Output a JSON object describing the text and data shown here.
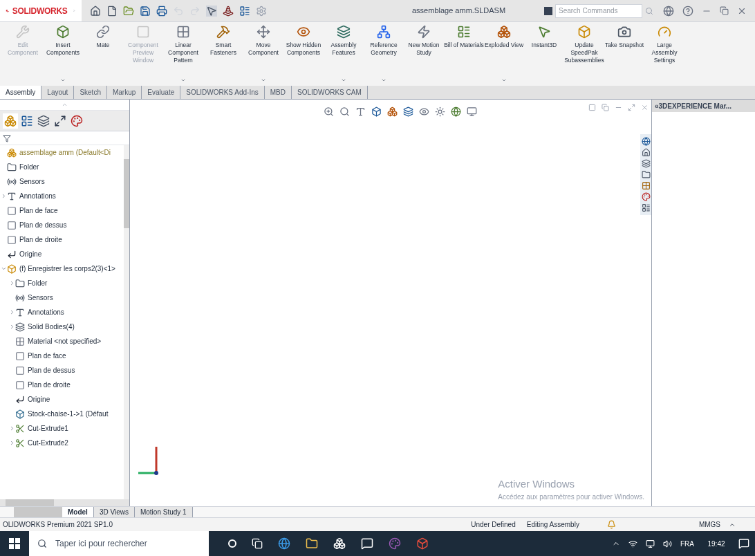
{
  "app": {
    "logo": "SOLIDWORKS",
    "document_title": "assemblage amm.SLDASM",
    "search": {
      "placeholder": "Search Commands"
    }
  },
  "ribbon": [
    {
      "label": "Edit Component",
      "disabled": true,
      "dropdown": false,
      "kind": "edit"
    },
    {
      "label": "Insert Components",
      "disabled": false,
      "dropdown": true,
      "kind": "insert"
    },
    {
      "label": "Mate",
      "disabled": false,
      "dropdown": false,
      "kind": "mate"
    },
    {
      "label": "Component Preview Window",
      "disabled": true,
      "dropdown": false,
      "kind": "preview"
    },
    {
      "label": "Linear Component Pattern",
      "disabled": false,
      "dropdown": true,
      "kind": "pattern"
    },
    {
      "label": "Smart Fasteners",
      "disabled": false,
      "dropdown": false,
      "kind": "fastener"
    },
    {
      "label": "Move Component",
      "disabled": false,
      "dropdown": true,
      "kind": "move"
    },
    {
      "label": "Show Hidden Components",
      "disabled": false,
      "dropdown": false,
      "kind": "show"
    },
    {
      "label": "Assembly Features",
      "disabled": false,
      "dropdown": true,
      "kind": "features"
    },
    {
      "label": "Reference Geometry",
      "disabled": false,
      "dropdown": true,
      "kind": "geometry"
    },
    {
      "label": "New Motion Study",
      "disabled": false,
      "dropdown": false,
      "kind": "motion"
    },
    {
      "label": "Bill of Materials",
      "disabled": false,
      "dropdown": false,
      "kind": "bom"
    },
    {
      "label": "Exploded View",
      "disabled": false,
      "dropdown": true,
      "kind": "explode"
    },
    {
      "label": "Instant3D",
      "disabled": false,
      "dropdown": false,
      "kind": "instant"
    },
    {
      "label": "Update SpeedPak Subassemblies",
      "disabled": false,
      "dropdown": false,
      "kind": "speedpak"
    },
    {
      "label": "Take Snapshot",
      "disabled": false,
      "dropdown": false,
      "kind": "snapshot"
    },
    {
      "label": "Large Assembly Settings",
      "disabled": false,
      "dropdown": false,
      "kind": "large"
    }
  ],
  "tabs": [
    {
      "label": "Assembly",
      "selected": true
    },
    {
      "label": "Layout",
      "selected": false
    },
    {
      "label": "Sketch",
      "selected": false
    },
    {
      "label": "Markup",
      "selected": false
    },
    {
      "label": "Evaluate",
      "selected": false
    },
    {
      "label": "SOLIDWORKS Add-Ins",
      "selected": false
    },
    {
      "label": "MBD",
      "selected": false
    },
    {
      "label": "SOLIDWORKS CAM",
      "selected": false
    }
  ],
  "tree": {
    "root": {
      "label": "assemblage amm  (Default<Di",
      "kind": "assembly",
      "children": [
        {
          "label": "Folder",
          "kind": "folder"
        },
        {
          "label": "Sensors",
          "kind": "sensor"
        },
        {
          "label": "Annotations",
          "expanded": false,
          "kind": "annotation"
        },
        {
          "label": "Plan de face",
          "kind": "plane"
        },
        {
          "label": "Plan de dessus",
          "kind": "plane"
        },
        {
          "label": "Plan de droite",
          "kind": "plane"
        },
        {
          "label": "Origine",
          "kind": "origin"
        },
        {
          "label": "(f) Enregistrer les corps2(3)<1>",
          "expanded": true,
          "kind": "part",
          "children": [
            {
              "label": "Folder",
              "expanded": false,
              "kind": "folder"
            },
            {
              "label": "Sensors",
              "kind": "sensor"
            },
            {
              "label": "Annotations",
              "expanded": false,
              "kind": "annotation"
            },
            {
              "label": "Solid Bodies(4)",
              "expanded": false,
              "kind": "bodies"
            },
            {
              "label": "Material <not specified>",
              "kind": "material"
            },
            {
              "label": "Plan de face",
              "kind": "plane"
            },
            {
              "label": "Plan de dessus",
              "kind": "plane"
            },
            {
              "label": "Plan de droite",
              "kind": "plane"
            },
            {
              "label": "Origine",
              "kind": "origin"
            },
            {
              "label": "Stock-chaise-1->1 (Défaut",
              "kind": "stock"
            },
            {
              "label": "Cut-Extrude1",
              "expanded": false,
              "kind": "cut"
            },
            {
              "label": "Cut-Extrude2",
              "expanded": false,
              "kind": "cut"
            }
          ]
        }
      ]
    }
  },
  "task_pane": {
    "title": "«3DEXPERIENCE Mar..."
  },
  "watermark_os": {
    "title": "Activer Windows",
    "text": "Accédez aux paramètres pour activer Windows."
  },
  "bottom_tabs": [
    {
      "label": "Model",
      "selected": true
    },
    {
      "label": "3D Views",
      "selected": false
    },
    {
      "label": "Motion Study 1",
      "selected": false
    }
  ],
  "status_bar": {
    "product": "OLIDWORKS Premium 2021 SP1.0",
    "state": "Under Defined",
    "mode": "Editing Assembly",
    "units": "MMGS"
  },
  "taskbar": {
    "search": {
      "placeholder": "Taper ici pour rechercher"
    },
    "language": "FRA",
    "time": "19:42"
  }
}
